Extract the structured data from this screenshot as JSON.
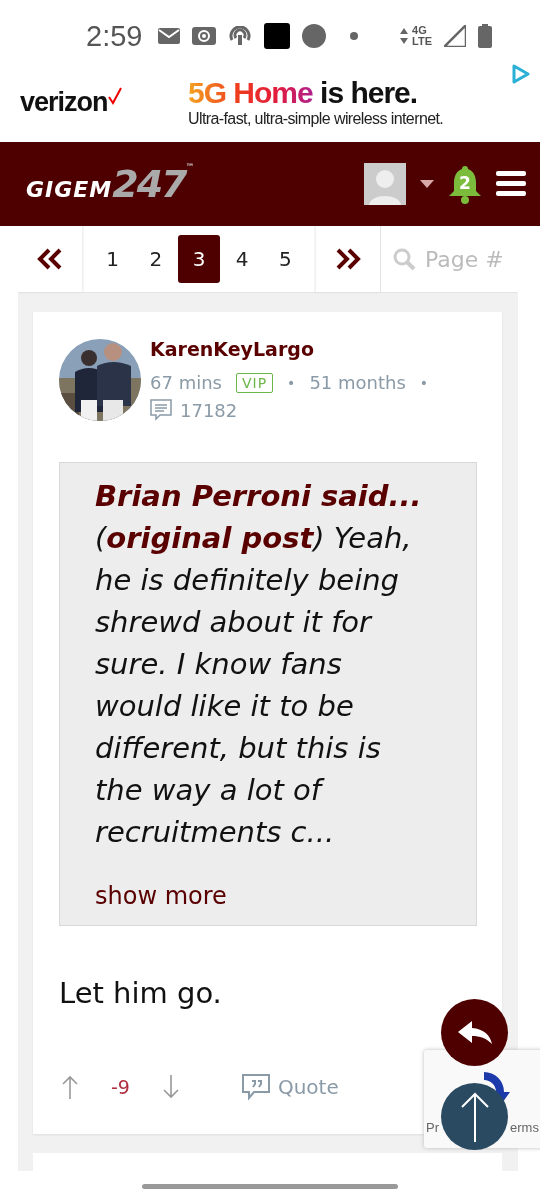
{
  "status_bar": {
    "time": "2:59",
    "network_top": "4G",
    "network_bottom": "LTE"
  },
  "ad": {
    "brand": "verizon",
    "headline_colored": "5G Home",
    "headline_rest": "is here.",
    "subline": "Ultra-fast, ultra-simple wireless internet."
  },
  "header": {
    "logo_main": "GIGEM",
    "logo_number": "247",
    "logo_mark": "™",
    "notifications": "2"
  },
  "pagination": {
    "pages": [
      {
        "label": "1",
        "selected": false
      },
      {
        "label": "2",
        "selected": false
      },
      {
        "label": "3",
        "selected": true
      },
      {
        "label": "4",
        "selected": false
      },
      {
        "label": "5",
        "selected": false
      }
    ],
    "search_placeholder": "Page #"
  },
  "post": {
    "author": "KarenKeyLargo",
    "time": "67 mins",
    "badge": "VIP",
    "separator": "•",
    "tenure": "51 months",
    "separator_2": "•",
    "post_count": "17182",
    "quote": {
      "title": "Brian Perroni said...",
      "body": "(**original post**) Yeah, he is definitely being shrewd about it for sure. I know fans would like it to be different, but this is the way a lot of recruitments c...",
      "show_more": "show more"
    },
    "message": "Let him go.",
    "score": "-9",
    "quote_button": "Quote"
  },
  "recaptcha": {
    "text_left": "Pr",
    "text_right": "erms"
  }
}
